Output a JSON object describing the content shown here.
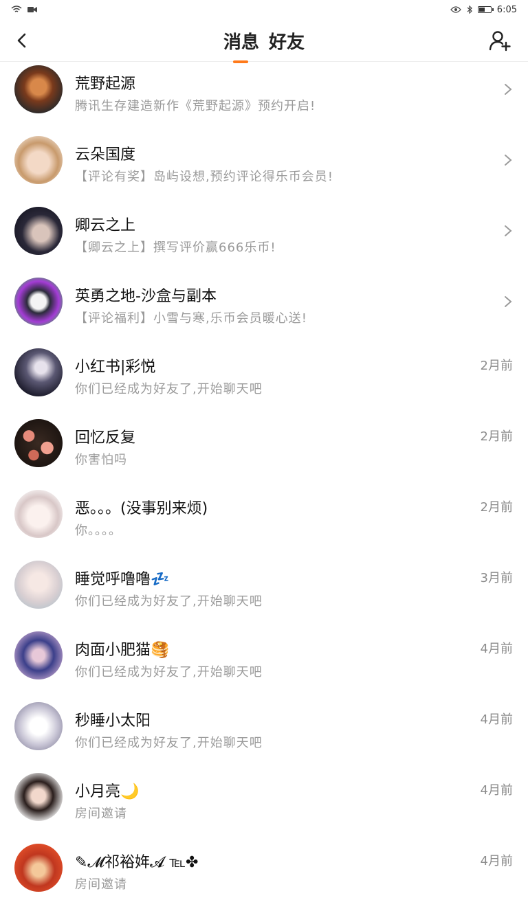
{
  "status_bar": {
    "time": "6:05"
  },
  "header": {
    "tabs": [
      {
        "label": "消息",
        "active": true
      },
      {
        "label": "好友",
        "active": false
      }
    ],
    "accent": "#ff7a1a"
  },
  "items": [
    {
      "name": "荒野起源",
      "preview": "腾讯生存建造新作《荒野起源》预约开启!",
      "time": "",
      "chevron": true
    },
    {
      "name": "云朵国度",
      "preview": "【评论有奖】岛屿设想,预约评论得乐币会员!",
      "time": "",
      "chevron": true
    },
    {
      "name": "卿云之上",
      "preview": "【卿云之上】撰写评价赢666乐币!",
      "time": "",
      "chevron": true
    },
    {
      "name": "英勇之地-沙盒与副本",
      "preview": "【评论福利】小雪与寒,乐币会员暖心送!",
      "time": "",
      "chevron": true
    },
    {
      "name": "小红书|彩悦",
      "preview": "你们已经成为好友了,开始聊天吧",
      "time": "2月前",
      "chevron": false
    },
    {
      "name": "回忆反复",
      "preview": "你害怕吗",
      "time": "2月前",
      "chevron": false
    },
    {
      "name": "恶。。。(没事别来烦)",
      "preview": "你。。。。",
      "time": "2月前",
      "chevron": false
    },
    {
      "name": "睡觉呼噜噜💤",
      "preview": "你们已经成为好友了,开始聊天吧",
      "time": "3月前",
      "chevron": false
    },
    {
      "name": "肉面小肥猫🥞",
      "preview": "你们已经成为好友了,开始聊天吧",
      "time": "4月前",
      "chevron": false
    },
    {
      "name": "秒睡小太阳",
      "preview": "你们已经成为好友了,开始聊天吧",
      "time": "4月前",
      "chevron": false
    },
    {
      "name": "小月亮🌙",
      "preview": "房间邀请",
      "time": "4月前",
      "chevron": false
    },
    {
      "name": "✎𝓜祁裕姩𝓐 ℡✤",
      "preview": "房间邀请",
      "time": "4月前",
      "chevron": false
    }
  ]
}
